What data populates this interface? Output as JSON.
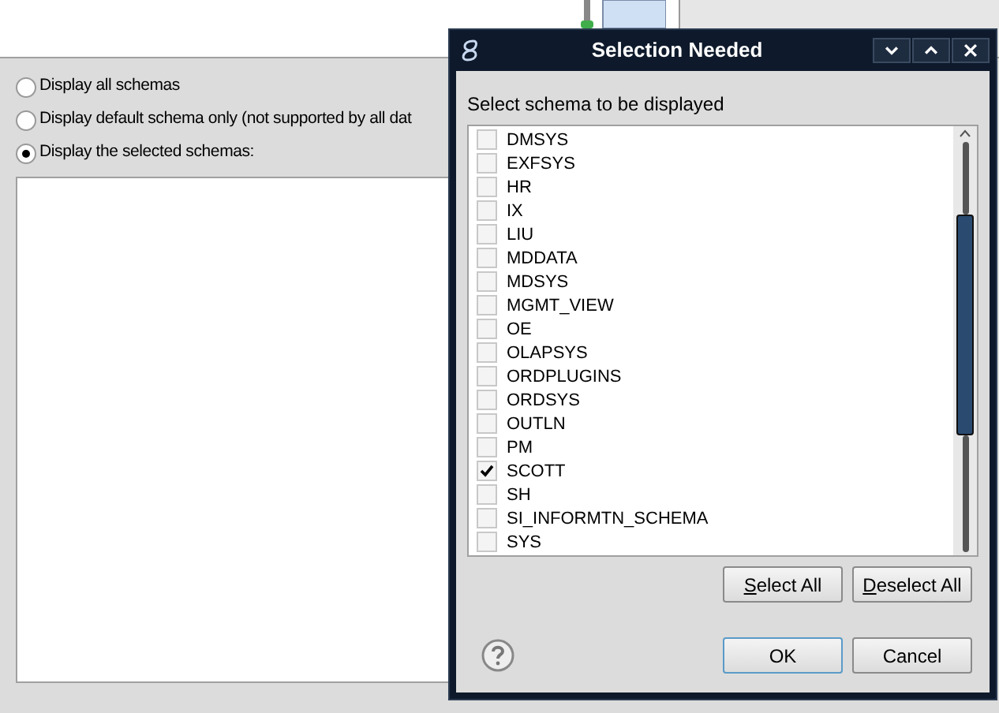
{
  "background": {
    "radios": [
      {
        "label": "Display all schemas",
        "selected": false
      },
      {
        "label": "Display default schema only (not supported by all dat",
        "selected": false
      },
      {
        "label": "Display the selected schemas:",
        "selected": true
      }
    ]
  },
  "dialog": {
    "title": "Selection Needed",
    "prompt": "Select schema to be displayed",
    "schemas": [
      {
        "name": "DMSYS",
        "checked": false
      },
      {
        "name": "EXFSYS",
        "checked": false
      },
      {
        "name": "HR",
        "checked": false
      },
      {
        "name": "IX",
        "checked": false
      },
      {
        "name": "LIU",
        "checked": false
      },
      {
        "name": "MDDATA",
        "checked": false
      },
      {
        "name": "MDSYS",
        "checked": false
      },
      {
        "name": "MGMT_VIEW",
        "checked": false
      },
      {
        "name": "OE",
        "checked": false
      },
      {
        "name": "OLAPSYS",
        "checked": false
      },
      {
        "name": "ORDPLUGINS",
        "checked": false
      },
      {
        "name": "ORDSYS",
        "checked": false
      },
      {
        "name": "OUTLN",
        "checked": false
      },
      {
        "name": "PM",
        "checked": false
      },
      {
        "name": "SCOTT",
        "checked": true
      },
      {
        "name": "SH",
        "checked": false
      },
      {
        "name": "SI_INFORMTN_SCHEMA",
        "checked": false
      },
      {
        "name": "SYS",
        "checked": false
      }
    ],
    "list_buttons": [
      {
        "mnemonic": "S",
        "rest": "elect All"
      },
      {
        "mnemonic": "D",
        "rest": "eselect All"
      }
    ],
    "buttons": [
      "OK",
      "Cancel"
    ]
  }
}
